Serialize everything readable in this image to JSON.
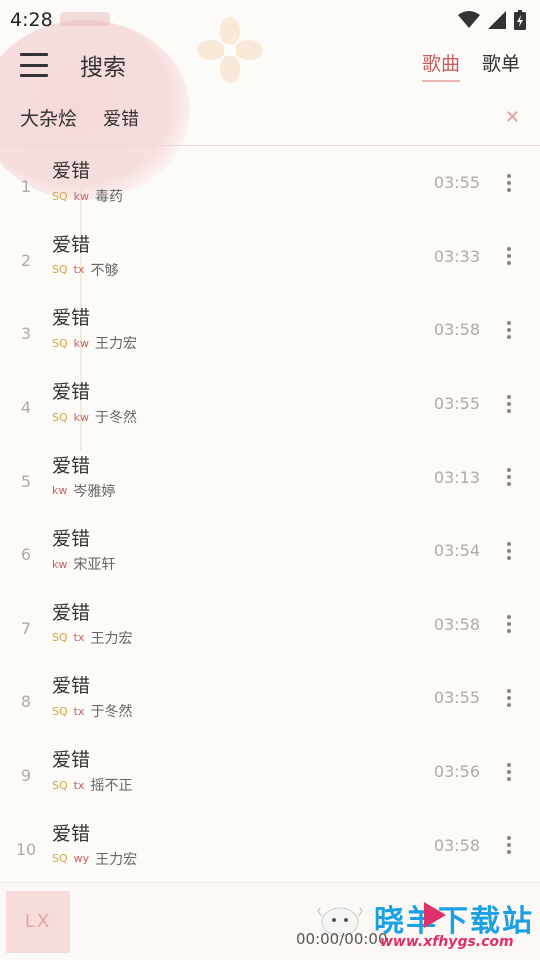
{
  "status": {
    "time": "4:28"
  },
  "header": {
    "title": "搜索",
    "tabs": [
      {
        "label": "歌曲",
        "active": true
      },
      {
        "label": "歌单",
        "active": false
      }
    ]
  },
  "search": {
    "source": "大杂烩",
    "query": "爱错"
  },
  "songs": [
    {
      "index": "1",
      "name": "爱错",
      "sq": "SQ",
      "src": "kw",
      "artist": "毒药",
      "duration": "03:55"
    },
    {
      "index": "2",
      "name": "爱错",
      "sq": "SQ",
      "src": "tx",
      "artist": "不够",
      "duration": "03:33"
    },
    {
      "index": "3",
      "name": "爱错",
      "sq": "SQ",
      "src": "kw",
      "artist": "王力宏",
      "duration": "03:58"
    },
    {
      "index": "4",
      "name": "爱错",
      "sq": "SQ",
      "src": "kw",
      "artist": "于冬然",
      "duration": "03:55"
    },
    {
      "index": "5",
      "name": "爱错",
      "sq": "",
      "src": "kw",
      "artist": "岑雅婷",
      "duration": "03:13"
    },
    {
      "index": "6",
      "name": "爱错",
      "sq": "",
      "src": "kw",
      "artist": "宋亚轩",
      "duration": "03:54"
    },
    {
      "index": "7",
      "name": "爱错",
      "sq": "SQ",
      "src": "tx",
      "artist": "王力宏",
      "duration": "03:58"
    },
    {
      "index": "8",
      "name": "爱错",
      "sq": "SQ",
      "src": "tx",
      "artist": "于冬然",
      "duration": "03:55"
    },
    {
      "index": "9",
      "name": "爱错",
      "sq": "SQ",
      "src": "tx",
      "artist": "摇不正",
      "duration": "03:56"
    },
    {
      "index": "10",
      "name": "爱错",
      "sq": "SQ",
      "src": "wy",
      "artist": "王力宏",
      "duration": "03:58"
    }
  ],
  "player": {
    "cover_text": "LX",
    "progress": "00:00/00:00"
  },
  "watermark": {
    "title": "晓羊下载站",
    "url": "www.xfhygs.com"
  },
  "colors": {
    "accent": "#c9605e",
    "sq": "#d4a44c",
    "background": "#fdfbf8"
  }
}
